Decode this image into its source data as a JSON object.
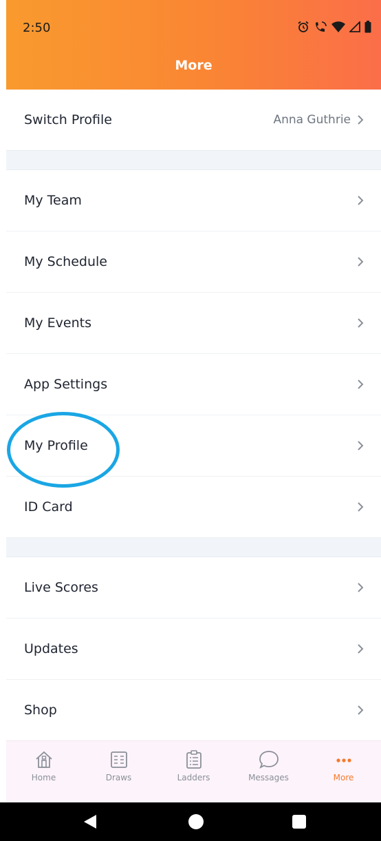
{
  "status_bar": {
    "time": "2:50",
    "icons": [
      "alarm-icon",
      "wifi-calling-icon",
      "wifi-icon",
      "signal-icon",
      "battery-icon"
    ]
  },
  "header": {
    "title": "More"
  },
  "menu": {
    "switch_profile": {
      "label": "Switch Profile",
      "value": "Anna Guthrie"
    },
    "group1": [
      {
        "label": "My Team"
      },
      {
        "label": "My Schedule"
      },
      {
        "label": "My Events"
      },
      {
        "label": "App Settings"
      },
      {
        "label": "My Profile"
      },
      {
        "label": "ID Card"
      }
    ],
    "group2": [
      {
        "label": "Live Scores"
      },
      {
        "label": "Updates"
      },
      {
        "label": "Shop"
      }
    ]
  },
  "tabbar": {
    "tabs": [
      {
        "label": "Home",
        "icon": "home-icon"
      },
      {
        "label": "Draws",
        "icon": "draws-icon"
      },
      {
        "label": "Ladders",
        "icon": "ladders-icon"
      },
      {
        "label": "Messages",
        "icon": "messages-icon"
      },
      {
        "label": "More",
        "icon": "more-icon",
        "active": true
      }
    ]
  },
  "colors": {
    "header_gradient_start": "#f99a2e",
    "header_gradient_end": "#fb6e49",
    "accent": "#f47a2a",
    "highlight_ring": "#1aa6e4"
  }
}
